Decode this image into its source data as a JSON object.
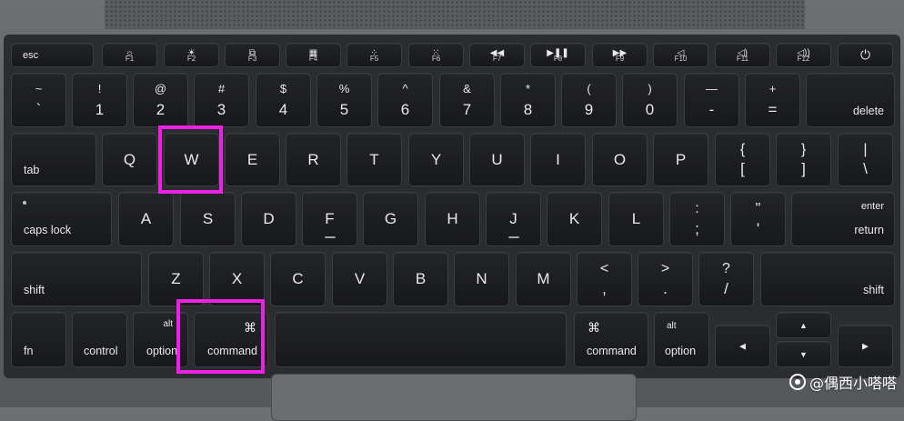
{
  "function_row": [
    {
      "id": "esc",
      "label": "esc"
    },
    {
      "id": "f1",
      "icon": "☼",
      "icon_name": "brightness-down-icon",
      "label": "F1"
    },
    {
      "id": "f2",
      "icon": "☀",
      "icon_name": "brightness-up-icon",
      "label": "F2"
    },
    {
      "id": "f3",
      "icon": "⧉",
      "icon_name": "mission-control-icon",
      "label": "F3"
    },
    {
      "id": "f4",
      "icon": "▦",
      "icon_name": "launchpad-icon",
      "label": "F4"
    },
    {
      "id": "f5",
      "icon": "⁘",
      "icon_name": "keyboard-backlight-down-icon",
      "label": "F5"
    },
    {
      "id": "f6",
      "icon": "⁙",
      "icon_name": "keyboard-backlight-up-icon",
      "label": "F6"
    },
    {
      "id": "f7",
      "icon": "◀◀",
      "icon_name": "rewind-icon",
      "label": "F7"
    },
    {
      "id": "f8",
      "icon": "▶❚❚",
      "icon_name": "play-pause-icon",
      "label": "F8"
    },
    {
      "id": "f9",
      "icon": "▶▶",
      "icon_name": "fast-forward-icon",
      "label": "F9"
    },
    {
      "id": "f10",
      "icon": "◁",
      "icon_name": "mute-icon",
      "label": "F10"
    },
    {
      "id": "f11",
      "icon": "◁)",
      "icon_name": "volume-down-icon",
      "label": "F11"
    },
    {
      "id": "f12",
      "icon": "◁))",
      "icon_name": "volume-up-icon",
      "label": "F12"
    },
    {
      "id": "power",
      "icon": "⏻",
      "icon_name": "power-icon"
    }
  ],
  "number_row": [
    {
      "id": "backtick",
      "top": "~",
      "bottom": "`"
    },
    {
      "id": "1",
      "top": "!",
      "bottom": "1"
    },
    {
      "id": "2",
      "top": "@",
      "bottom": "2"
    },
    {
      "id": "3",
      "top": "#",
      "bottom": "3"
    },
    {
      "id": "4",
      "top": "$",
      "bottom": "4"
    },
    {
      "id": "5",
      "top": "%",
      "bottom": "5"
    },
    {
      "id": "6",
      "top": "^",
      "bottom": "6"
    },
    {
      "id": "7",
      "top": "&",
      "bottom": "7"
    },
    {
      "id": "8",
      "top": "*",
      "bottom": "8"
    },
    {
      "id": "9",
      "top": "(",
      "bottom": "9"
    },
    {
      "id": "0",
      "top": ")",
      "bottom": "0"
    },
    {
      "id": "minus",
      "top": "—",
      "bottom": "-"
    },
    {
      "id": "equals",
      "top": "+",
      "bottom": "="
    },
    {
      "id": "delete",
      "label": "delete"
    }
  ],
  "qwerty_row": [
    {
      "id": "tab",
      "label": "tab"
    },
    {
      "id": "q",
      "label": "Q"
    },
    {
      "id": "w",
      "label": "W"
    },
    {
      "id": "e",
      "label": "E"
    },
    {
      "id": "r",
      "label": "R"
    },
    {
      "id": "t",
      "label": "T"
    },
    {
      "id": "y",
      "label": "Y"
    },
    {
      "id": "u",
      "label": "U"
    },
    {
      "id": "i",
      "label": "I"
    },
    {
      "id": "o",
      "label": "O"
    },
    {
      "id": "p",
      "label": "P"
    },
    {
      "id": "lbracket",
      "top": "{",
      "bottom": "["
    },
    {
      "id": "rbracket",
      "top": "}",
      "bottom": "]"
    },
    {
      "id": "backslash",
      "top": "|",
      "bottom": "\\"
    }
  ],
  "home_row": [
    {
      "id": "capslock",
      "label": "caps lock"
    },
    {
      "id": "a",
      "label": "A"
    },
    {
      "id": "s",
      "label": "S"
    },
    {
      "id": "d",
      "label": "D"
    },
    {
      "id": "f",
      "label": "F"
    },
    {
      "id": "g",
      "label": "G"
    },
    {
      "id": "h",
      "label": "H"
    },
    {
      "id": "j",
      "label": "J"
    },
    {
      "id": "k",
      "label": "K"
    },
    {
      "id": "l",
      "label": "L"
    },
    {
      "id": "semicolon",
      "top": ":",
      "bottom": ";"
    },
    {
      "id": "quote",
      "top": "\"",
      "bottom": "'"
    },
    {
      "id": "return",
      "top": "enter",
      "label": "return"
    }
  ],
  "shift_row": [
    {
      "id": "lshift",
      "label": "shift"
    },
    {
      "id": "z",
      "label": "Z"
    },
    {
      "id": "x",
      "label": "X"
    },
    {
      "id": "c",
      "label": "C"
    },
    {
      "id": "v",
      "label": "V"
    },
    {
      "id": "b",
      "label": "B"
    },
    {
      "id": "n",
      "label": "N"
    },
    {
      "id": "m",
      "label": "M"
    },
    {
      "id": "comma",
      "top": "<",
      "bottom": ","
    },
    {
      "id": "period",
      "top": ">",
      "bottom": "."
    },
    {
      "id": "slash",
      "top": "?",
      "bottom": "/"
    },
    {
      "id": "rshift",
      "label": "shift"
    }
  ],
  "bottom_row": [
    {
      "id": "fn",
      "label": "fn"
    },
    {
      "id": "control",
      "label": "control"
    },
    {
      "id": "loption",
      "top": "alt",
      "label": "option"
    },
    {
      "id": "lcommand",
      "symbol": "⌘",
      "label": "command"
    },
    {
      "id": "space",
      "label": ""
    },
    {
      "id": "rcommand",
      "symbol": "⌘",
      "label": "command"
    },
    {
      "id": "roption",
      "top": "alt",
      "label": "option"
    },
    {
      "id": "left",
      "icon": "◀",
      "icon_name": "arrow-left-icon"
    },
    {
      "id": "up",
      "icon": "▲",
      "icon_name": "arrow-up-icon"
    },
    {
      "id": "down",
      "icon": "▼",
      "icon_name": "arrow-down-icon"
    },
    {
      "id": "right",
      "icon": "▶",
      "icon_name": "arrow-right-icon"
    }
  ],
  "highlights": [
    {
      "target": "w",
      "color": "#ee20e6"
    },
    {
      "target": "lcommand",
      "color": "#ee20e6"
    }
  ],
  "watermark": {
    "text": "@偶西小嗒嗒"
  },
  "colors": {
    "key": "#1a1b1e",
    "key_text": "#e9e9ec",
    "highlight": "#ee20e6",
    "body": "#5c5e62"
  }
}
